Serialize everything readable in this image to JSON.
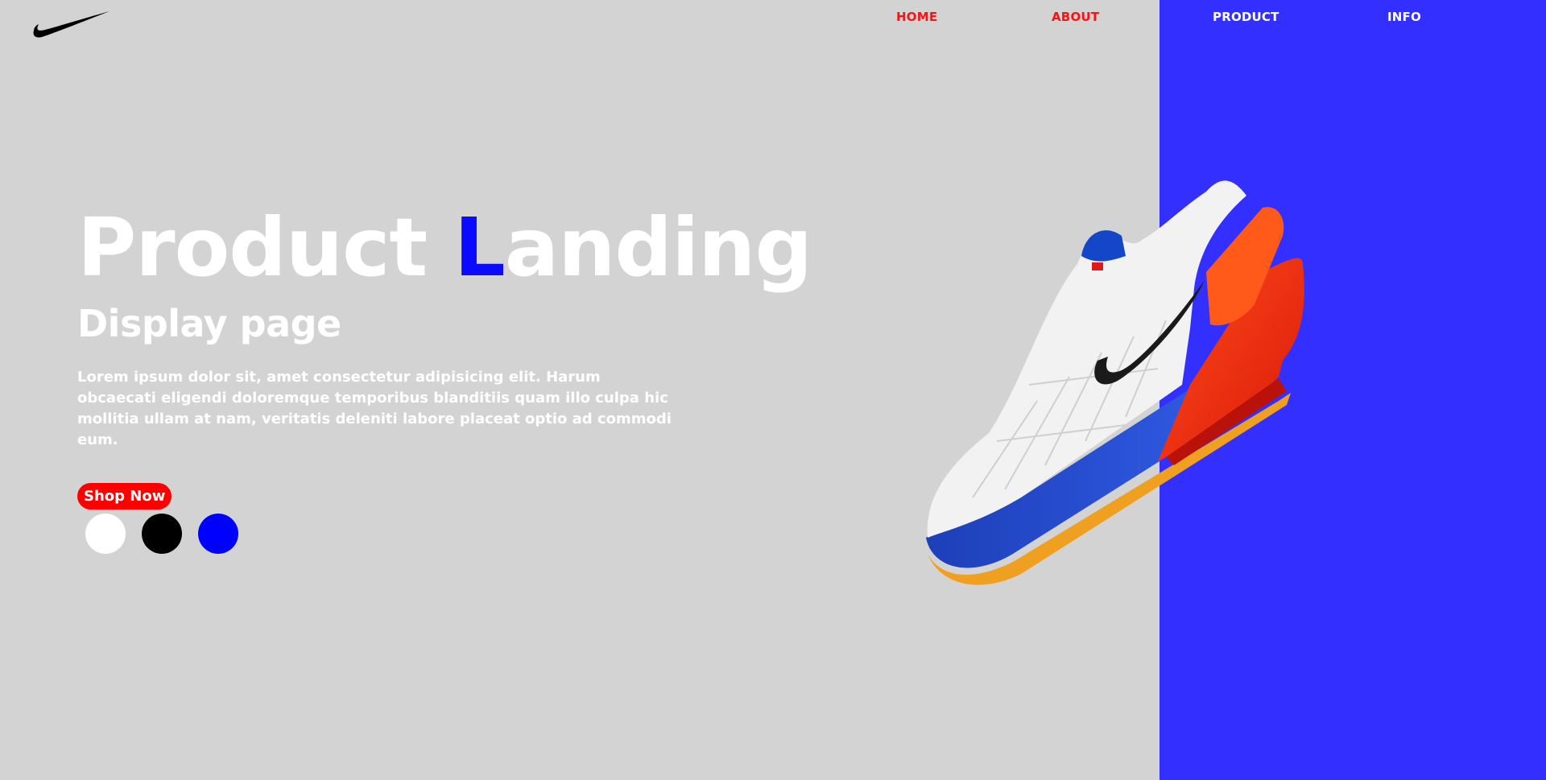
{
  "nav": {
    "home": "HOME",
    "about": "ABOUT",
    "product": "PRODUCT",
    "info": "INFO"
  },
  "hero": {
    "title_before": "Product ",
    "title_accent": "L",
    "title_after": "anding",
    "subtitle": "Display page",
    "description": "Lorem ipsum dolor sit, amet consectetur adipisicing elit. Harum obcaecati eligendi doloremque temporibus blanditiis quam illo culpa hic mollitia ullam at nam, veritatis deleniti labore placeat optio ad commodi eum.",
    "cta": "Shop Now"
  },
  "swatches": [
    {
      "name": "white",
      "color": "#ffffff"
    },
    {
      "name": "black",
      "color": "#000000"
    },
    {
      "name": "blue",
      "color": "#0000ff"
    }
  ],
  "colors": {
    "background": "#d3d3d3",
    "panel": "#3330ff",
    "nav_active": "#ff1111",
    "accent": "#0a0aff",
    "cta": "#ff0000"
  },
  "icons": {
    "logo": "swoosh-logo-icon",
    "product_image": "running-shoe-image"
  }
}
